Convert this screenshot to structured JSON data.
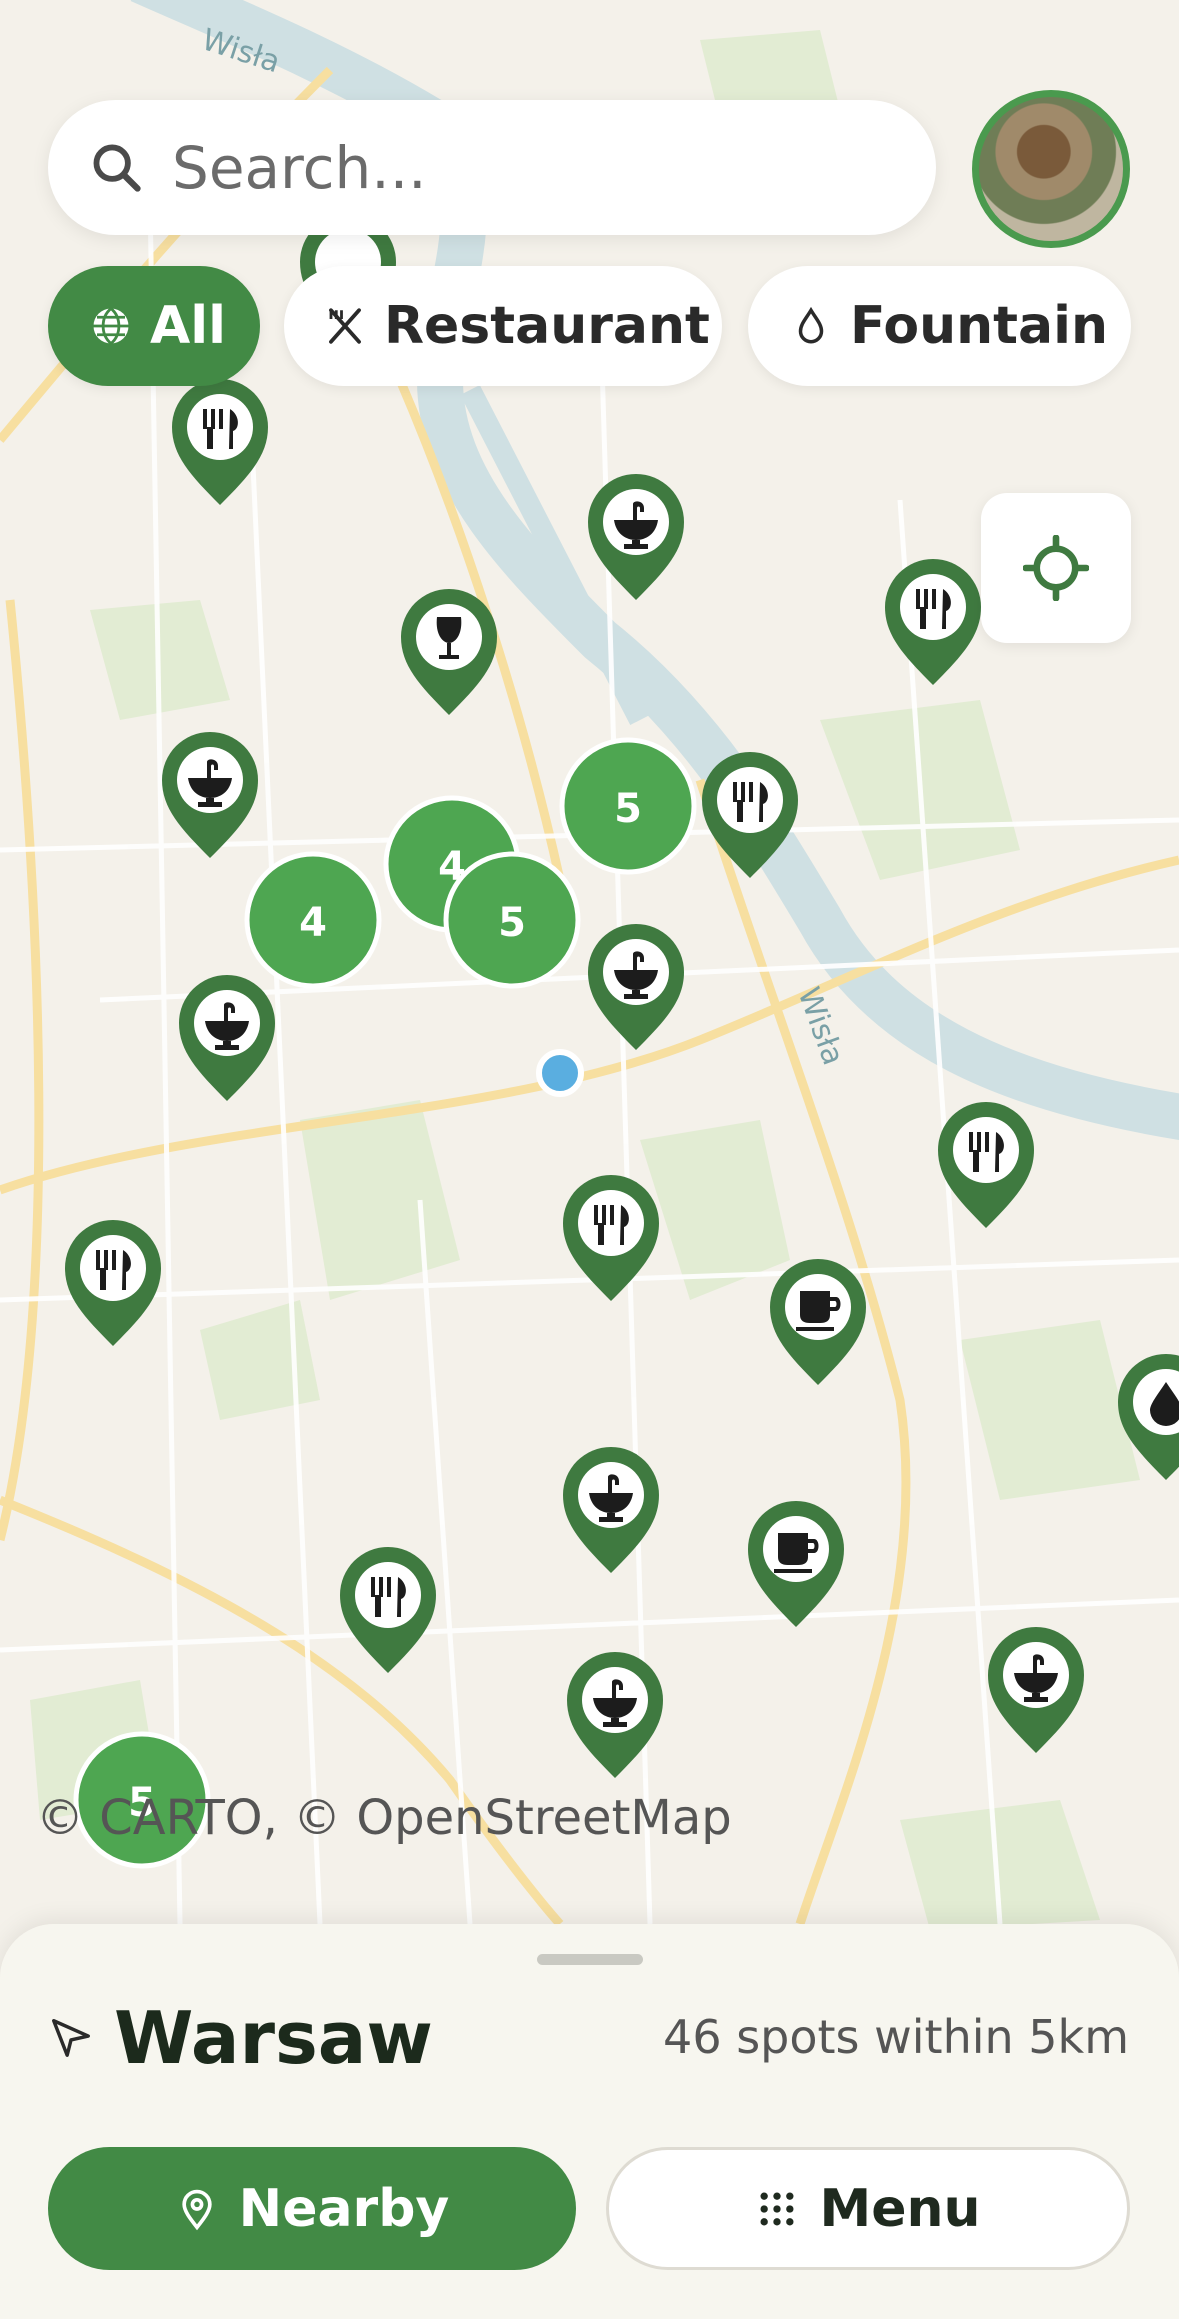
{
  "search": {
    "placeholder": "Search..."
  },
  "filters": [
    {
      "label": "All",
      "icon": "globe-icon",
      "active": true
    },
    {
      "label": "Restaurant",
      "icon": "utensils-icon",
      "active": false
    },
    {
      "label": "Fountain",
      "icon": "drop-icon",
      "active": false
    }
  ],
  "map": {
    "river_labels": [
      "Wisła",
      "Wisła"
    ],
    "attribution": "© CARTO, © OpenStreetMap",
    "clusters": [
      "5",
      "4",
      "4",
      "5",
      "5"
    ]
  },
  "sheet": {
    "city": "Warsaw",
    "spots": "46 spots within 5km",
    "nearby_label": "Nearby",
    "menu_label": "Menu"
  },
  "colors": {
    "accent": "#428a45",
    "pin": "#3f7a40",
    "cluster": "#4ea651",
    "user_dot": "#5aaee0"
  }
}
